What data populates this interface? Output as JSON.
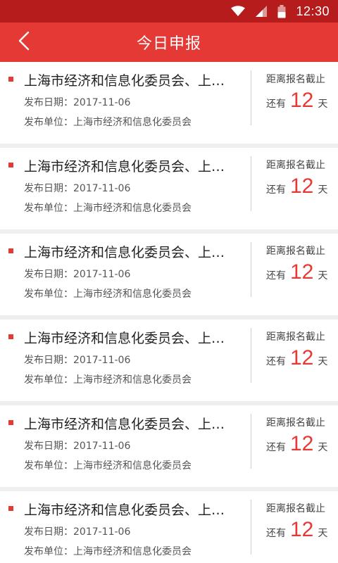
{
  "status_bar": {
    "time": "12:30",
    "icons": [
      "wifi-icon",
      "signal-icon",
      "battery-icon"
    ]
  },
  "header": {
    "title": "今日申报",
    "back_icon": "chevron-left-icon",
    "background": "#e53935"
  },
  "theme": {
    "accent": "#e53935",
    "status_bar_bg": "#b71c1c"
  },
  "items": [
    {
      "title": "上海市经济和信息化委员会、上…",
      "date_label": "发布日期：",
      "date": "2017-11-06",
      "unit_label": "发布单位：",
      "unit": "上海市经济和信息化委员会",
      "deadline_label": "距离报名截止",
      "remaining_prefix": "还有",
      "remaining_days": "12",
      "remaining_suffix": "天"
    },
    {
      "title": "上海市经济和信息化委员会、上…",
      "date_label": "发布日期：",
      "date": "2017-11-06",
      "unit_label": "发布单位：",
      "unit": "上海市经济和信息化委员会",
      "deadline_label": "距离报名截止",
      "remaining_prefix": "还有",
      "remaining_days": "12",
      "remaining_suffix": "天"
    },
    {
      "title": "上海市经济和信息化委员会、上…",
      "date_label": "发布日期：",
      "date": "2017-11-06",
      "unit_label": "发布单位：",
      "unit": "上海市经济和信息化委员会",
      "deadline_label": "距离报名截止",
      "remaining_prefix": "还有",
      "remaining_days": "12",
      "remaining_suffix": "天"
    },
    {
      "title": "上海市经济和信息化委员会、上…",
      "date_label": "发布日期：",
      "date": "2017-11-06",
      "unit_label": "发布单位：",
      "unit": "上海市经济和信息化委员会",
      "deadline_label": "距离报名截止",
      "remaining_prefix": "还有",
      "remaining_days": "12",
      "remaining_suffix": "天"
    },
    {
      "title": "上海市经济和信息化委员会、上…",
      "date_label": "发布日期：",
      "date": "2017-11-06",
      "unit_label": "发布单位：",
      "unit": "上海市经济和信息化委员会",
      "deadline_label": "距离报名截止",
      "remaining_prefix": "还有",
      "remaining_days": "12",
      "remaining_suffix": "天"
    },
    {
      "title": "上海市经济和信息化委员会、上…",
      "date_label": "发布日期：",
      "date": "2017-11-06",
      "unit_label": "发布单位：",
      "unit": "上海市经济和信息化委员会",
      "deadline_label": "距离报名截止",
      "remaining_prefix": "还有",
      "remaining_days": "12",
      "remaining_suffix": "天"
    }
  ]
}
